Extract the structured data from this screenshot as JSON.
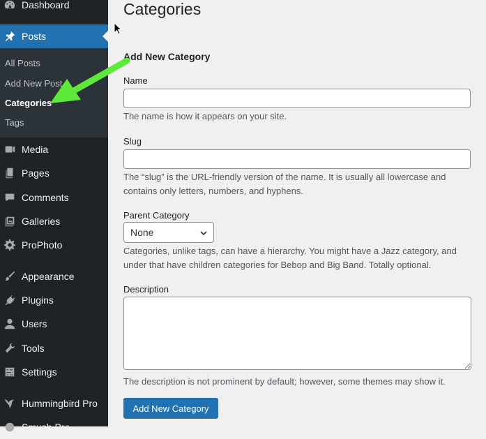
{
  "colors": {
    "sidebar_bg": "#1d2327",
    "submenu_bg": "#2c3338",
    "accent": "#2271b1",
    "page_bg": "#f0f0f1",
    "annotation_arrow": "#5ee83a"
  },
  "sidebar": {
    "dashboard": {
      "label": "Dashboard",
      "icon": "dashboard-icon"
    },
    "posts": {
      "label": "Posts",
      "icon": "pin-icon"
    },
    "submenu": [
      "All Posts",
      "Add New Post",
      "Categories",
      "Tags"
    ],
    "items": [
      {
        "label": "Media",
        "icon": "media-icon"
      },
      {
        "label": "Pages",
        "icon": "pages-icon"
      },
      {
        "label": "Comments",
        "icon": "comment-icon"
      },
      {
        "label": "Galleries",
        "icon": "gallery-icon"
      },
      {
        "label": "ProPhoto",
        "icon": "gear-icon"
      },
      {
        "label": "Appearance",
        "icon": "paintbrush-icon"
      },
      {
        "label": "Plugins",
        "icon": "plug-icon"
      },
      {
        "label": "Users",
        "icon": "user-icon"
      },
      {
        "label": "Tools",
        "icon": "wrench-icon"
      },
      {
        "label": "Settings",
        "icon": "settings-icon"
      },
      {
        "label": "Hummingbird Pro",
        "icon": "hummingbird-icon"
      },
      {
        "label": "Smush Pro",
        "icon": "smush-icon"
      }
    ]
  },
  "main": {
    "title": "Categories",
    "form_heading": "Add New Category",
    "name": {
      "label": "Name",
      "value": "",
      "help": "The name is how it appears on your site."
    },
    "slug": {
      "label": "Slug",
      "value": "",
      "help": "The “slug” is the URL-friendly version of the name. It is usually all lowercase and contains only letters, numbers, and hyphens."
    },
    "parent": {
      "label": "Parent Category",
      "selected": "None",
      "help": "Categories, unlike tags, can have a hierarchy. You might have a Jazz category, and under that have children categories for Bebop and Big Band. Totally optional."
    },
    "description": {
      "label": "Description",
      "value": "",
      "help": "The description is not prominent by default; however, some themes may show it."
    },
    "submit_label": "Add New Category"
  }
}
